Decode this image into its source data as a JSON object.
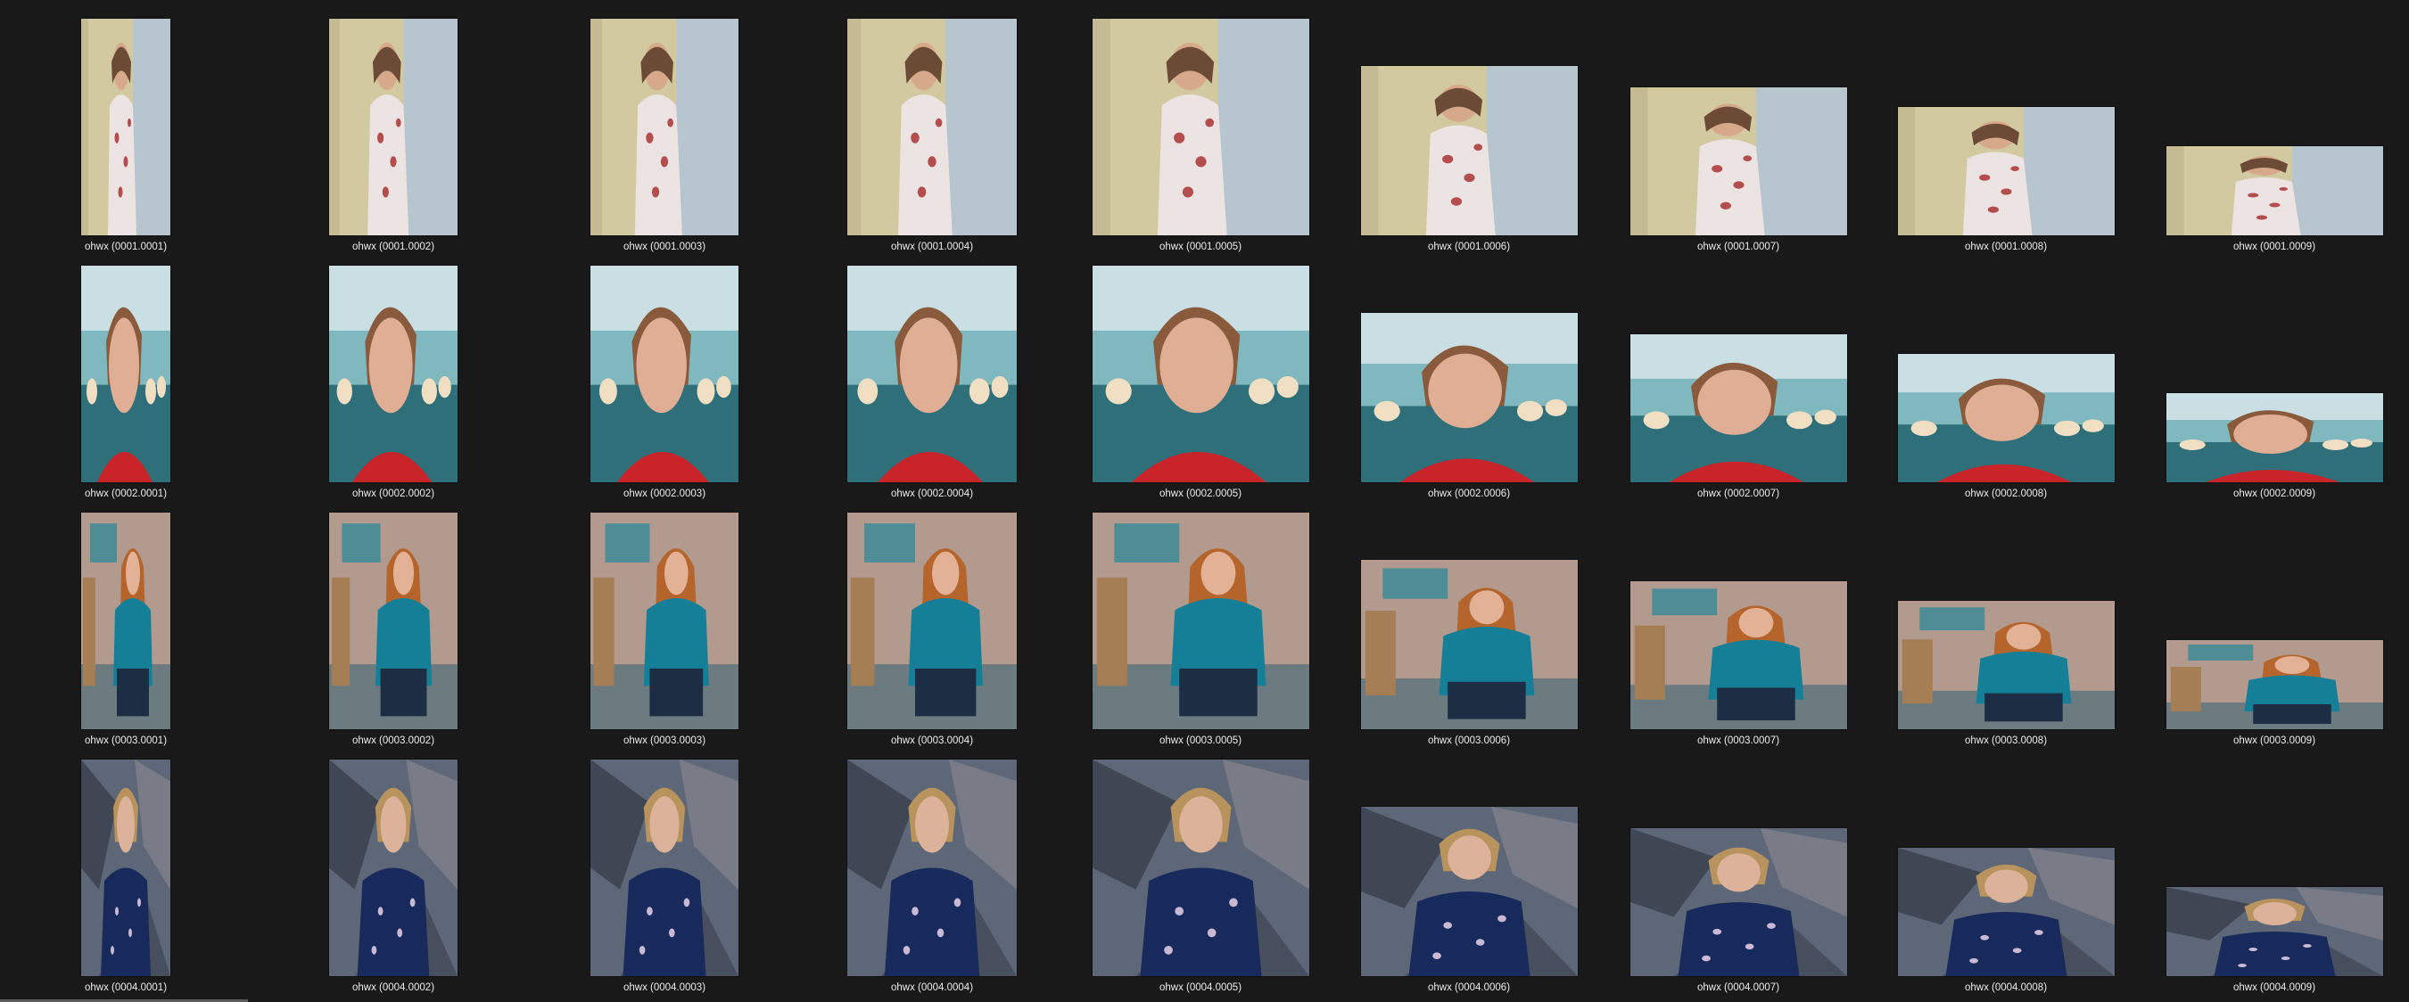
{
  "view": {
    "name": "file-explorer-large-icons",
    "background": "#191919"
  },
  "row_labels_prefix": "ohwx",
  "rows": [
    {
      "subject": "woman-in-floral-dress-beside-white-pillar",
      "palette": {
        "bg": "#d3c9a1",
        "stripe": "#a89d78",
        "accent": "#b7c5cf",
        "body": "#ece4e2",
        "pattern": "#b44d4d",
        "skin": "#d6a98a",
        "hair": "#6b4a36"
      },
      "items": [
        {
          "label": "ohwx (0001.0001)"
        },
        {
          "label": "ohwx (0001.0002)"
        },
        {
          "label": "ohwx (0001.0003)"
        },
        {
          "label": "ohwx (0001.0004)"
        },
        {
          "label": "ohwx (0001.0005)"
        },
        {
          "label": "ohwx (0001.0006)"
        },
        {
          "label": "ohwx (0001.0007)"
        },
        {
          "label": "ohwx (0001.0008)"
        },
        {
          "label": "ohwx (0001.0009)"
        }
      ]
    },
    {
      "subject": "close-up-portrait-woman-teal-bokeh",
      "palette": {
        "bg": "#7fb8bf",
        "stripe": "#2e6f79",
        "accent": "#f1dfc4",
        "body": "#c8242a",
        "pattern": "#f2d9d9",
        "skin": "#dfae95",
        "hair": "#8a5a3c"
      },
      "items": [
        {
          "label": "ohwx (0002.0001)"
        },
        {
          "label": "ohwx (0002.0002)"
        },
        {
          "label": "ohwx (0002.0003)"
        },
        {
          "label": "ohwx (0002.0004)"
        },
        {
          "label": "ohwx (0002.0005)"
        },
        {
          "label": "ohwx (0002.0006)"
        },
        {
          "label": "ohwx (0002.0007)"
        },
        {
          "label": "ohwx (0002.0008)"
        },
        {
          "label": "ohwx (0002.0009)"
        }
      ]
    },
    {
      "subject": "redhead-woman-teal-sweater-sitting-on-steps",
      "palette": {
        "bg": "#b29a8e",
        "stripe": "#4e8d96",
        "accent": "#a57e55",
        "body": "#147f96",
        "pattern": "#1d2d44",
        "skin": "#e2b196",
        "hair": "#b5652b"
      },
      "items": [
        {
          "label": "ohwx (0003.0001)"
        },
        {
          "label": "ohwx (0003.0002)"
        },
        {
          "label": "ohwx (0003.0003)"
        },
        {
          "label": "ohwx (0003.0004)"
        },
        {
          "label": "ohwx (0003.0005)"
        },
        {
          "label": "ohwx (0003.0006)"
        },
        {
          "label": "ohwx (0003.0007)"
        },
        {
          "label": "ohwx (0003.0008)"
        },
        {
          "label": "ohwx (0003.0009)"
        }
      ]
    },
    {
      "subject": "woman-navy-floral-blouse-against-rock",
      "palette": {
        "bg": "#5d6778",
        "stripe": "#3f4654",
        "accent": "#8c8a90",
        "body": "#182a5c",
        "pattern": "#c9b9d4",
        "skin": "#dcb39a",
        "hair": "#b8935d"
      },
      "items": [
        {
          "label": "ohwx (0004.0001)"
        },
        {
          "label": "ohwx (0004.0002)"
        },
        {
          "label": "ohwx (0004.0003)"
        },
        {
          "label": "ohwx (0004.0004)"
        },
        {
          "label": "ohwx (0004.0005)"
        },
        {
          "label": "ohwx (0004.0006)"
        },
        {
          "label": "ohwx (0004.0007)"
        },
        {
          "label": "ohwx (0004.0008)"
        },
        {
          "label": "ohwx (0004.0009)"
        }
      ]
    }
  ]
}
